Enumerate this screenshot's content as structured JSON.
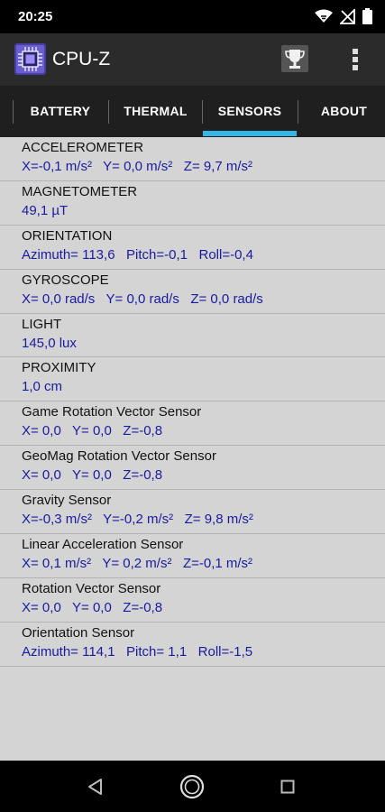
{
  "status_bar": {
    "time": "20:25",
    "icons": [
      "wifi-icon",
      "no-signal-icon",
      "battery-icon"
    ]
  },
  "app": {
    "title": "CPU-Z",
    "logo_icon": "cpu-chip-icon",
    "accent_color": "#33b5e5"
  },
  "tabs": [
    {
      "label": "BATTERY",
      "active": false
    },
    {
      "label": "THERMAL",
      "active": false
    },
    {
      "label": "SENSORS",
      "active": true
    },
    {
      "label": "ABOUT",
      "active": false
    }
  ],
  "sensors": [
    {
      "name": "ACCELEROMETER",
      "value": "X=-0,1 m/s²   Y= 0,0 m/s²   Z= 9,7 m/s²"
    },
    {
      "name": "MAGNETOMETER",
      "value": "49,1 µT"
    },
    {
      "name": "ORIENTATION",
      "value": "Azimuth= 113,6   Pitch=-0,1   Roll=-0,4"
    },
    {
      "name": "GYROSCOPE",
      "value": "X= 0,0 rad/s   Y= 0,0 rad/s   Z= 0,0 rad/s"
    },
    {
      "name": "LIGHT",
      "value": "145,0 lux"
    },
    {
      "name": "PROXIMITY",
      "value": "1,0 cm"
    },
    {
      "name": "Game Rotation Vector Sensor",
      "value": "X= 0,0   Y= 0,0   Z=-0,8"
    },
    {
      "name": "GeoMag Rotation Vector Sensor",
      "value": "X= 0,0   Y= 0,0   Z=-0,8"
    },
    {
      "name": "Gravity Sensor",
      "value": "X=-0,3 m/s²   Y=-0,2 m/s²   Z= 9,8 m/s²"
    },
    {
      "name": "Linear Acceleration Sensor",
      "value": "X= 0,1 m/s²   Y= 0,2 m/s²   Z=-0,1 m/s²"
    },
    {
      "name": "Rotation Vector Sensor",
      "value": "X= 0,0   Y= 0,0   Z=-0,8"
    },
    {
      "name": "Orientation Sensor",
      "value": "Azimuth= 114,1   Pitch= 1,1   Roll=-1,5"
    }
  ],
  "nav_bar": {
    "buttons": [
      "back-icon",
      "home-icon",
      "recents-icon"
    ]
  }
}
